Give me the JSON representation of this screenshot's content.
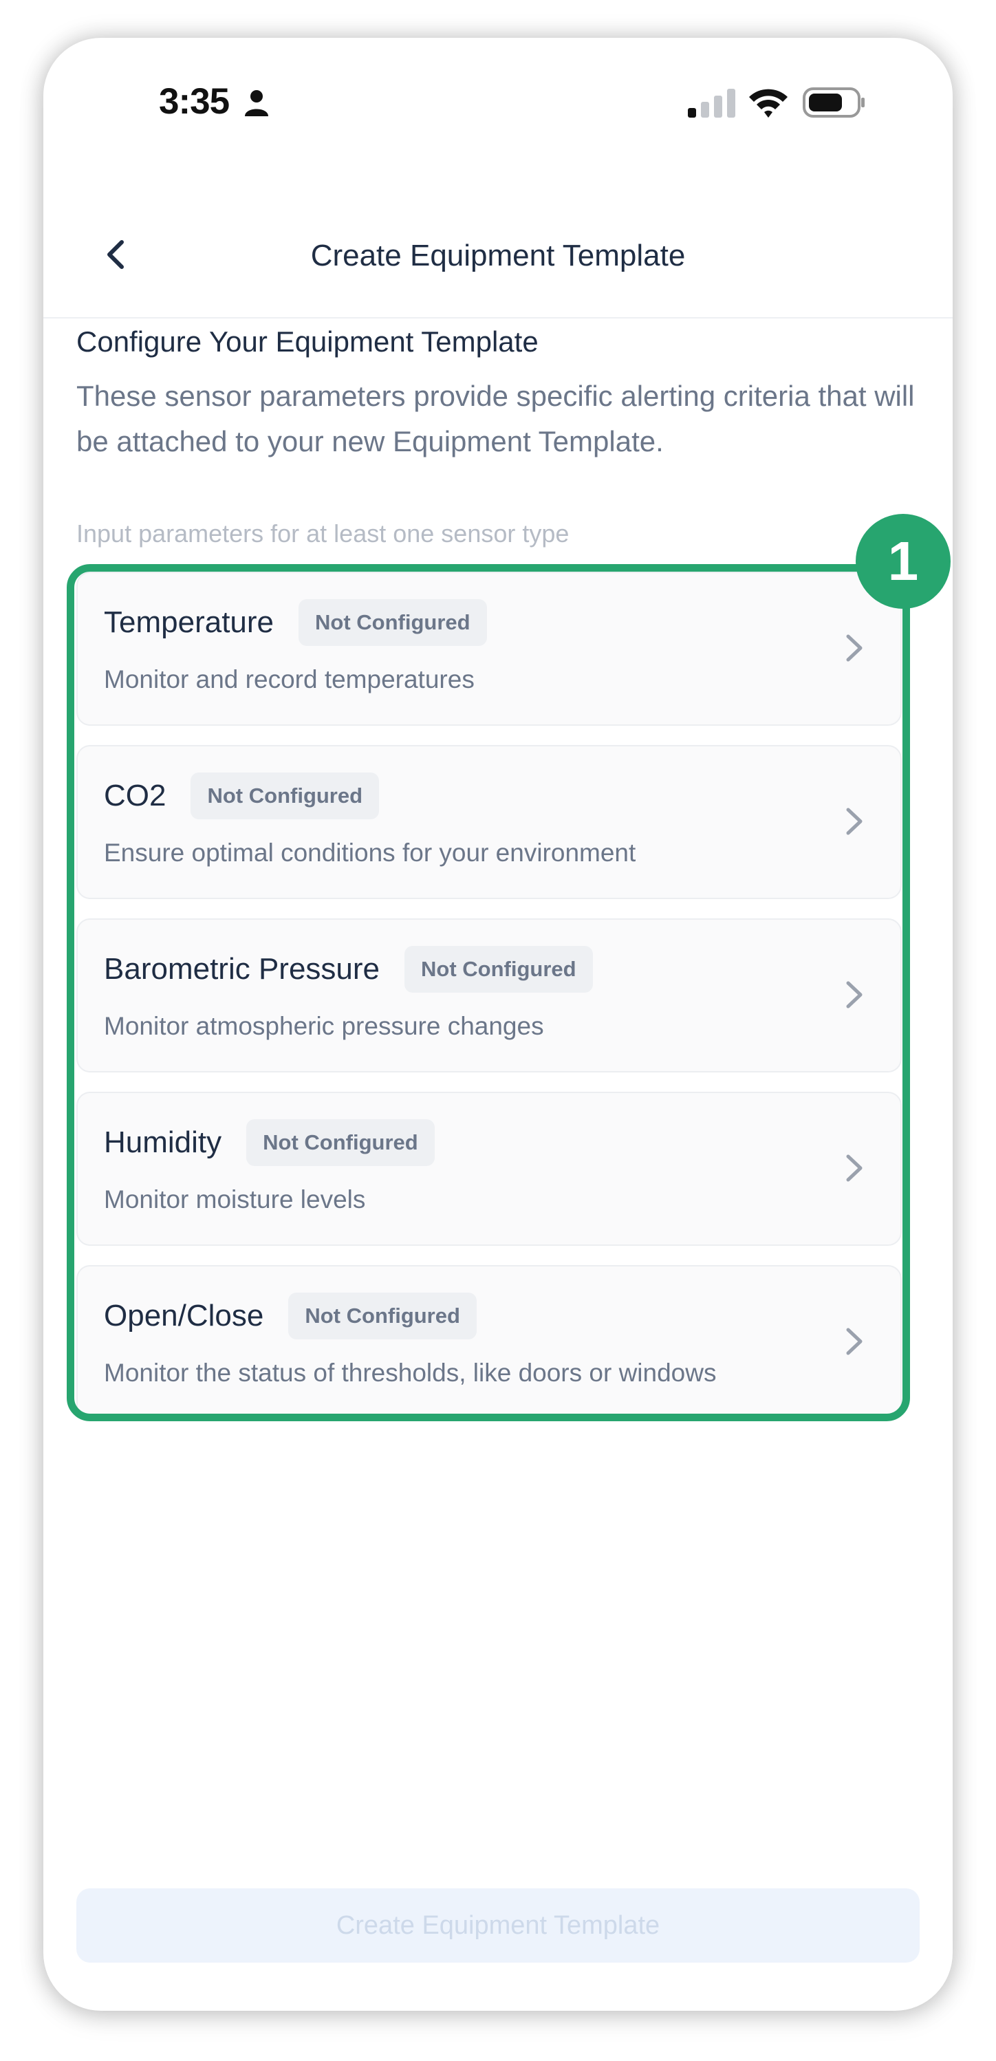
{
  "status_bar": {
    "time": "3:35",
    "icons": [
      "person-icon",
      "signal-icon",
      "wifi-icon",
      "battery-icon"
    ]
  },
  "header": {
    "title": "Create Equipment Template",
    "back_icon": "chevron-left-icon"
  },
  "intro": {
    "title": "Configure Your Equipment Template",
    "description": "These sensor parameters provide specific alerting criteria that will be attached to your new Equipment Template."
  },
  "hint": "Input parameters for at least one sensor type",
  "callout_number": "1",
  "sensors": [
    {
      "name": "Temperature",
      "status": "Not Configured",
      "description": "Monitor and record temperatures"
    },
    {
      "name": "CO2",
      "status": "Not Configured",
      "description": "Ensure optimal conditions for your environment"
    },
    {
      "name": "Barometric Pressure",
      "status": "Not Configured",
      "description": "Monitor atmospheric pressure changes"
    },
    {
      "name": "Humidity",
      "status": "Not Configured",
      "description": "Monitor moisture levels"
    },
    {
      "name": "Open/Close",
      "status": "Not Configured",
      "description": "Monitor the status of thresholds, like doors or windows"
    }
  ],
  "footer": {
    "create_label": "Create Equipment Template"
  },
  "colors": {
    "accent_green": "#27a56f",
    "title_text": "#1f2d44",
    "muted_text": "#6b7689",
    "disabled_button_bg": "#edf3fc"
  }
}
